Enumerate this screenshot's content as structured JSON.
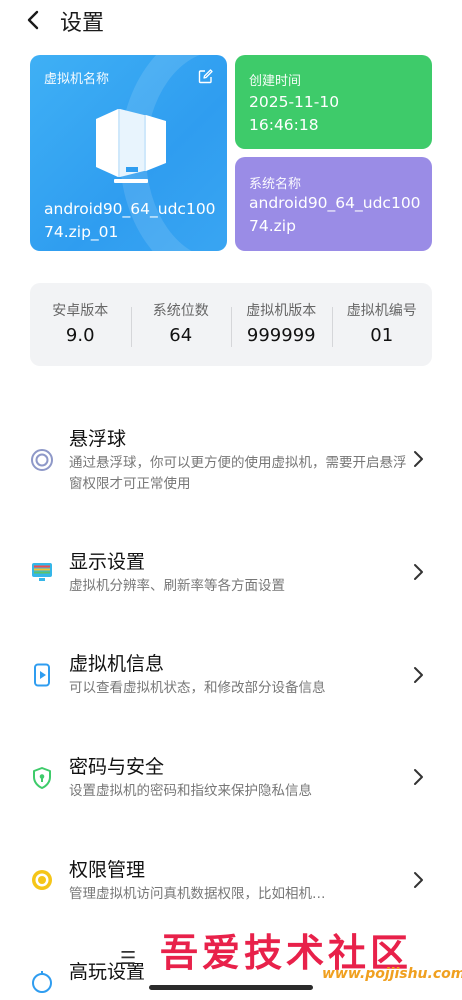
{
  "header": {
    "title": "设置",
    "back_icon": "back-arrow-icon"
  },
  "vm_card": {
    "label": "虚拟机名称",
    "value": "android90_64_udc10074.zip_01",
    "color": "#38a8f3"
  },
  "time_card": {
    "label": "创建时间",
    "date": "2025-11-10",
    "time": "16:46:18",
    "color": "#3ecb6a"
  },
  "sys_card": {
    "label": "系统名称",
    "value": "android90_64_udc10074.zip",
    "color": "#9a8ce6"
  },
  "stats": [
    {
      "label": "安卓版本",
      "value": "9.0"
    },
    {
      "label": "系统位数",
      "value": "64"
    },
    {
      "label": "虚拟机版本",
      "value": "999999"
    },
    {
      "label": "虚拟机编号",
      "value": "01"
    }
  ],
  "menu": [
    {
      "title": "悬浮球",
      "desc": "通过悬浮球，你可以更方便的使用虚拟机，需要开启悬浮窗权限才可正常使用",
      "icon": "floating-ball-icon"
    },
    {
      "title": "显示设置",
      "desc": "虚拟机分辨率、刷新率等各方面设置",
      "icon": "display-icon"
    },
    {
      "title": "虚拟机信息",
      "desc": "可以查看虚拟机状态，和修改部分设备信息",
      "icon": "vm-info-icon"
    },
    {
      "title": "密码与安全",
      "desc": "设置虚拟机的密码和指纹来保护隐私信息",
      "icon": "shield-icon"
    },
    {
      "title": "权限管理",
      "desc": "管理虚拟机访问真机数据权限，比如相机…",
      "icon": "permission-icon"
    },
    {
      "title": "高玩设置",
      "desc": "",
      "icon": "gamepad-icon"
    }
  ],
  "watermark": {
    "text": "吾爱技术社区",
    "url": "www.pojjishu.com"
  },
  "floating_control": "☰"
}
